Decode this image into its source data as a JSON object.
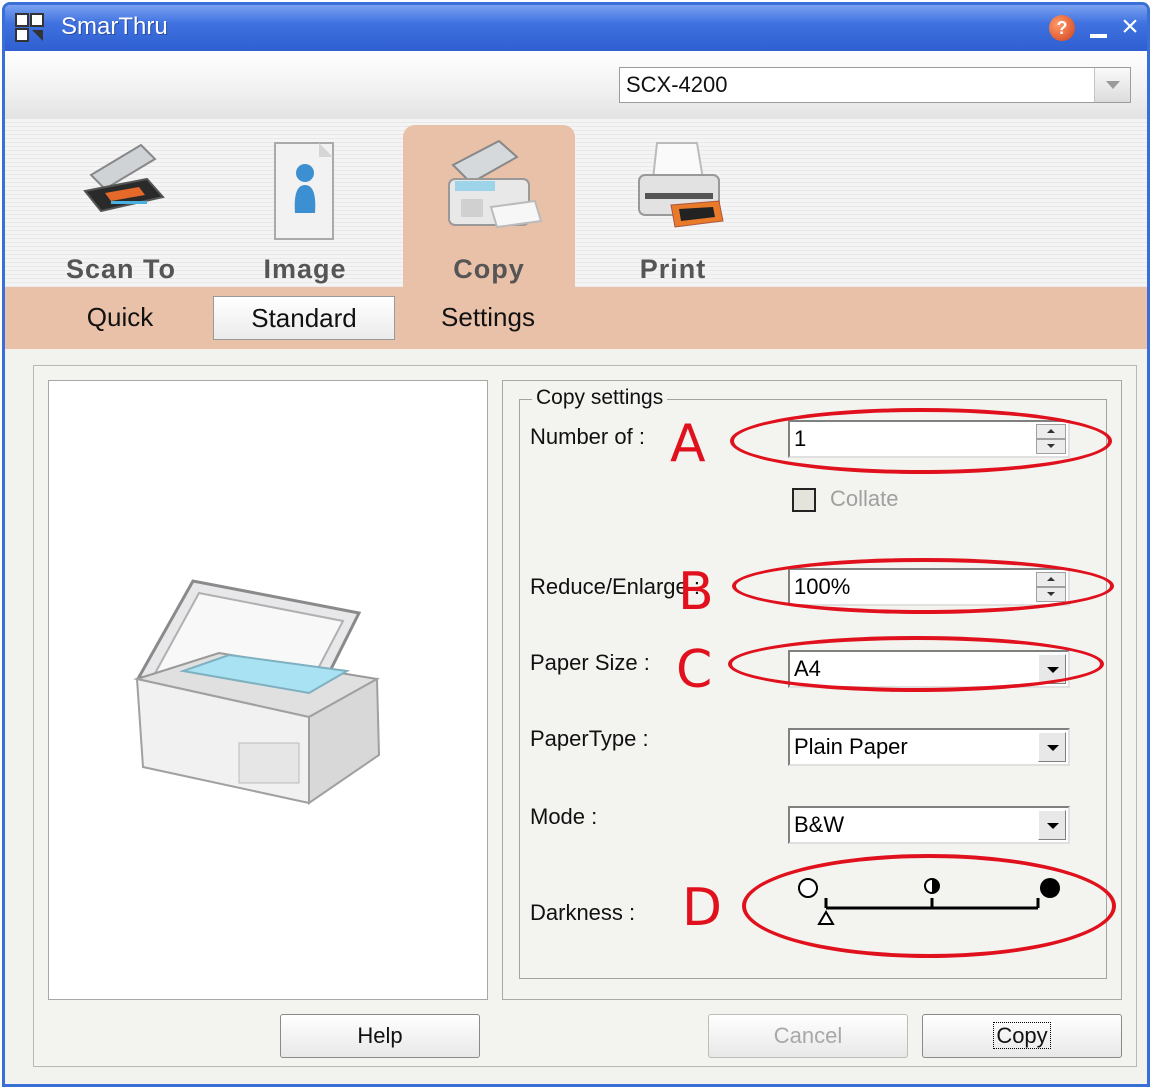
{
  "window": {
    "title": "SmarThru"
  },
  "device": {
    "selected": "SCX-4200"
  },
  "tabs": [
    {
      "label": "Scan To",
      "icon": "scanner-icon"
    },
    {
      "label": "Image",
      "icon": "image-document-icon"
    },
    {
      "label": "Copy",
      "icon": "copier-icon",
      "active": true
    },
    {
      "label": "Print",
      "icon": "printer-icon"
    }
  ],
  "subtabs": [
    {
      "label": "Quick"
    },
    {
      "label": "Standard",
      "selected": true
    },
    {
      "label": "Settings"
    }
  ],
  "copy_settings": {
    "legend": "Copy settings",
    "number_of": {
      "label": "Number of :",
      "value": "1"
    },
    "collate": {
      "label": "Collate",
      "checked": false,
      "enabled": false
    },
    "reduce_enlarge": {
      "label": "Reduce/Enlarge :",
      "value": "100%"
    },
    "paper_size": {
      "label": "Paper Size :",
      "value": "A4"
    },
    "paper_type": {
      "label": "PaperType :",
      "value": "Plain Paper"
    },
    "mode": {
      "label": "Mode :",
      "value": "B&W"
    },
    "darkness": {
      "label": "Darkness :",
      "level": 0
    }
  },
  "annotations": [
    "A",
    "B",
    "C",
    "D"
  ],
  "buttons": {
    "help": "Help",
    "cancel": "Cancel",
    "copy": "Copy"
  },
  "colors": {
    "title_bar": "#3f71e0",
    "tab_active": "#e9c1a8",
    "annotation": "#e0101c"
  }
}
